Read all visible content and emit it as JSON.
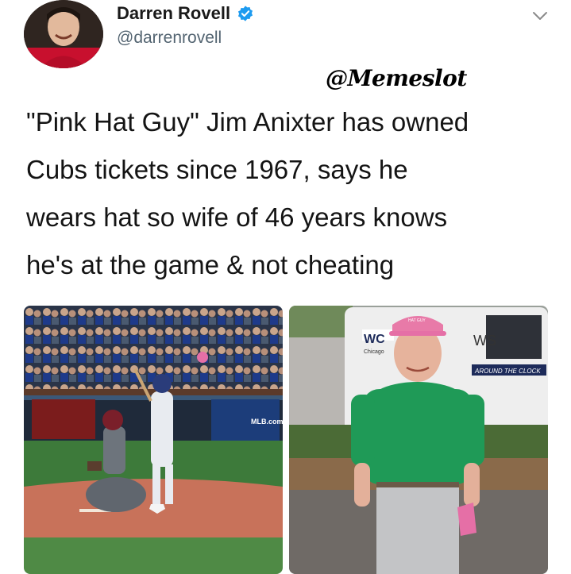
{
  "author": {
    "name": "Darren Rovell",
    "handle": "@darrenrovell",
    "avatar_icon": "profile-avatar",
    "verified_icon": "verified-badge-icon",
    "verified_color": "#1d9bf0"
  },
  "menu_icon": "chevron-down-icon",
  "watermark": "@Memeslot",
  "tweet": {
    "lines": [
      "\"Pink Hat Guy\" Jim Anixter has owned",
      "Cubs tickets since 1967, says he",
      "wears hat so wife of 46 years knows",
      "he's at the game & not cheating"
    ]
  },
  "media": {
    "left": {
      "sign_text": "MLB.com"
    },
    "right": {
      "van_text_1": "WC",
      "van_text_2": "Chicago",
      "van_text_3": "WS",
      "van_text_4": "AROUND THE CLOCK",
      "hat_text": "HAT GUY"
    }
  }
}
